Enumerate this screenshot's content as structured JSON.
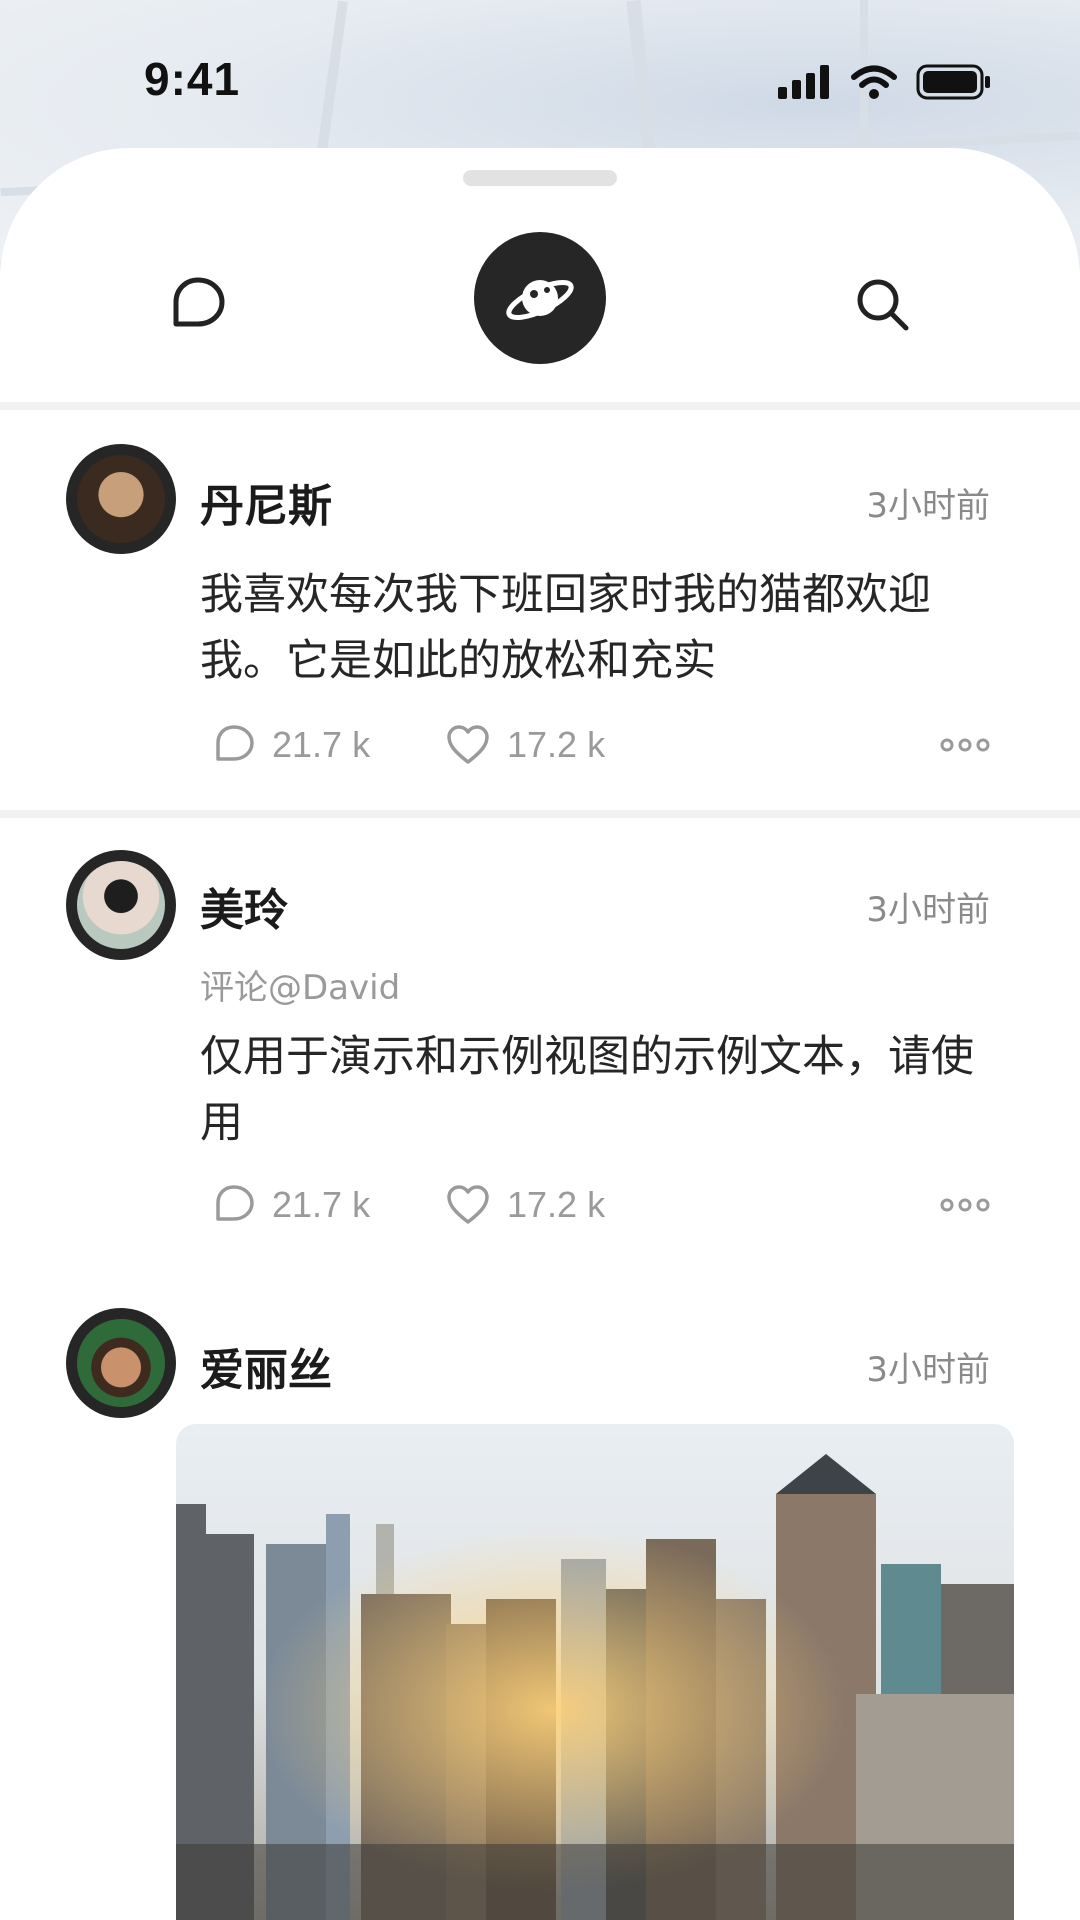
{
  "status": {
    "time": "9:41"
  },
  "nav": {
    "chat": "chat-bubble-icon",
    "center": "planet-icon",
    "search": "search-icon"
  },
  "posts": [
    {
      "author": "丹尼斯",
      "time": "3小时前",
      "text": "我喜欢每次我下班回家时我的猫都欢迎我。它是如此的放松和充实",
      "comments": "21.7 k",
      "likes": "17.2 k"
    },
    {
      "author": "美玲",
      "time": "3小时前",
      "mention": "评论@David",
      "text": "仅用于演示和示例视图的示例文本，请使用",
      "comments": "21.7 k",
      "likes": "17.2 k"
    },
    {
      "author": "爱丽丝",
      "time": "3小时前",
      "image": "city-skyline-photo"
    }
  ]
}
